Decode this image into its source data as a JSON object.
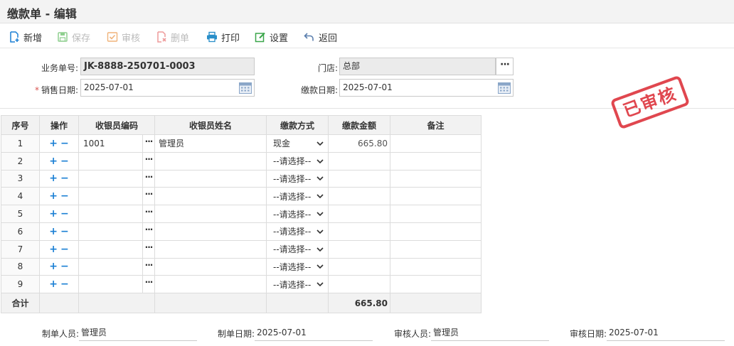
{
  "window": {
    "title": "缴款单 - 编辑"
  },
  "toolbar": {
    "new_label": "新增",
    "save_label": "保存",
    "audit_label": "审核",
    "delete_label": "删单",
    "print_label": "打印",
    "settings_label": "设置",
    "back_label": "返回"
  },
  "form": {
    "doc_no_label": "业务单号:",
    "doc_no_value": "JK-8888-250701-0003",
    "store_label": "门店:",
    "store_value": "总部",
    "sale_date_required": "*",
    "sale_date_label": "销售日期:",
    "sale_date_value": "2025-07-01",
    "pay_date_label": "缴款日期:",
    "pay_date_value": "2025-07-01"
  },
  "stamp": {
    "text": "已审核",
    "color": "#e0474f"
  },
  "grid": {
    "headers": [
      "序号",
      "操作",
      "收银员编码",
      "收银员姓名",
      "缴款方式",
      "缴款金额",
      "备注"
    ],
    "rows": [
      {
        "seq": "1",
        "code": "1001",
        "name": "管理员",
        "method": "现金",
        "amount": "665.80",
        "note": ""
      },
      {
        "seq": "2",
        "code": "",
        "name": "",
        "method": "--请选择--",
        "amount": "",
        "note": ""
      },
      {
        "seq": "3",
        "code": "",
        "name": "",
        "method": "--请选择--",
        "amount": "",
        "note": ""
      },
      {
        "seq": "4",
        "code": "",
        "name": "",
        "method": "--请选择--",
        "amount": "",
        "note": ""
      },
      {
        "seq": "5",
        "code": "",
        "name": "",
        "method": "--请选择--",
        "amount": "",
        "note": ""
      },
      {
        "seq": "6",
        "code": "",
        "name": "",
        "method": "--请选择--",
        "amount": "",
        "note": ""
      },
      {
        "seq": "7",
        "code": "",
        "name": "",
        "method": "--请选择--",
        "amount": "",
        "note": ""
      },
      {
        "seq": "8",
        "code": "",
        "name": "",
        "method": "--请选择--",
        "amount": "",
        "note": ""
      },
      {
        "seq": "9",
        "code": "",
        "name": "",
        "method": "--请选择--",
        "amount": "",
        "note": ""
      }
    ],
    "total_label": "合计",
    "total_amount": "665.80",
    "plus_glyph": "+",
    "minus_glyph": "−",
    "dots_glyph": "···"
  },
  "footer": {
    "maker_label": "制单人员:",
    "maker_value": "管理员",
    "make_date_label": "制单日期:",
    "make_date_value": "2025-07-01",
    "auditor_label": "审核人员:",
    "auditor_value": "管理员",
    "audit_date_label": "审核日期:",
    "audit_date_value": "2025-07-01"
  },
  "colors": {
    "accent_blue": "#1a7fd4",
    "stamp_red": "#e0474f",
    "disabled_gray": "#bbbbbb"
  },
  "icons": {
    "new": "add-doc-icon",
    "save": "save-icon",
    "audit": "check-icon",
    "delete": "delete-doc-icon",
    "print": "print-icon",
    "settings": "edit-icon",
    "back": "back-arrow-icon",
    "calendar": "calendar-icon",
    "lookup": "ellipsis-icon",
    "dropdown": "chevron-down-icon"
  }
}
